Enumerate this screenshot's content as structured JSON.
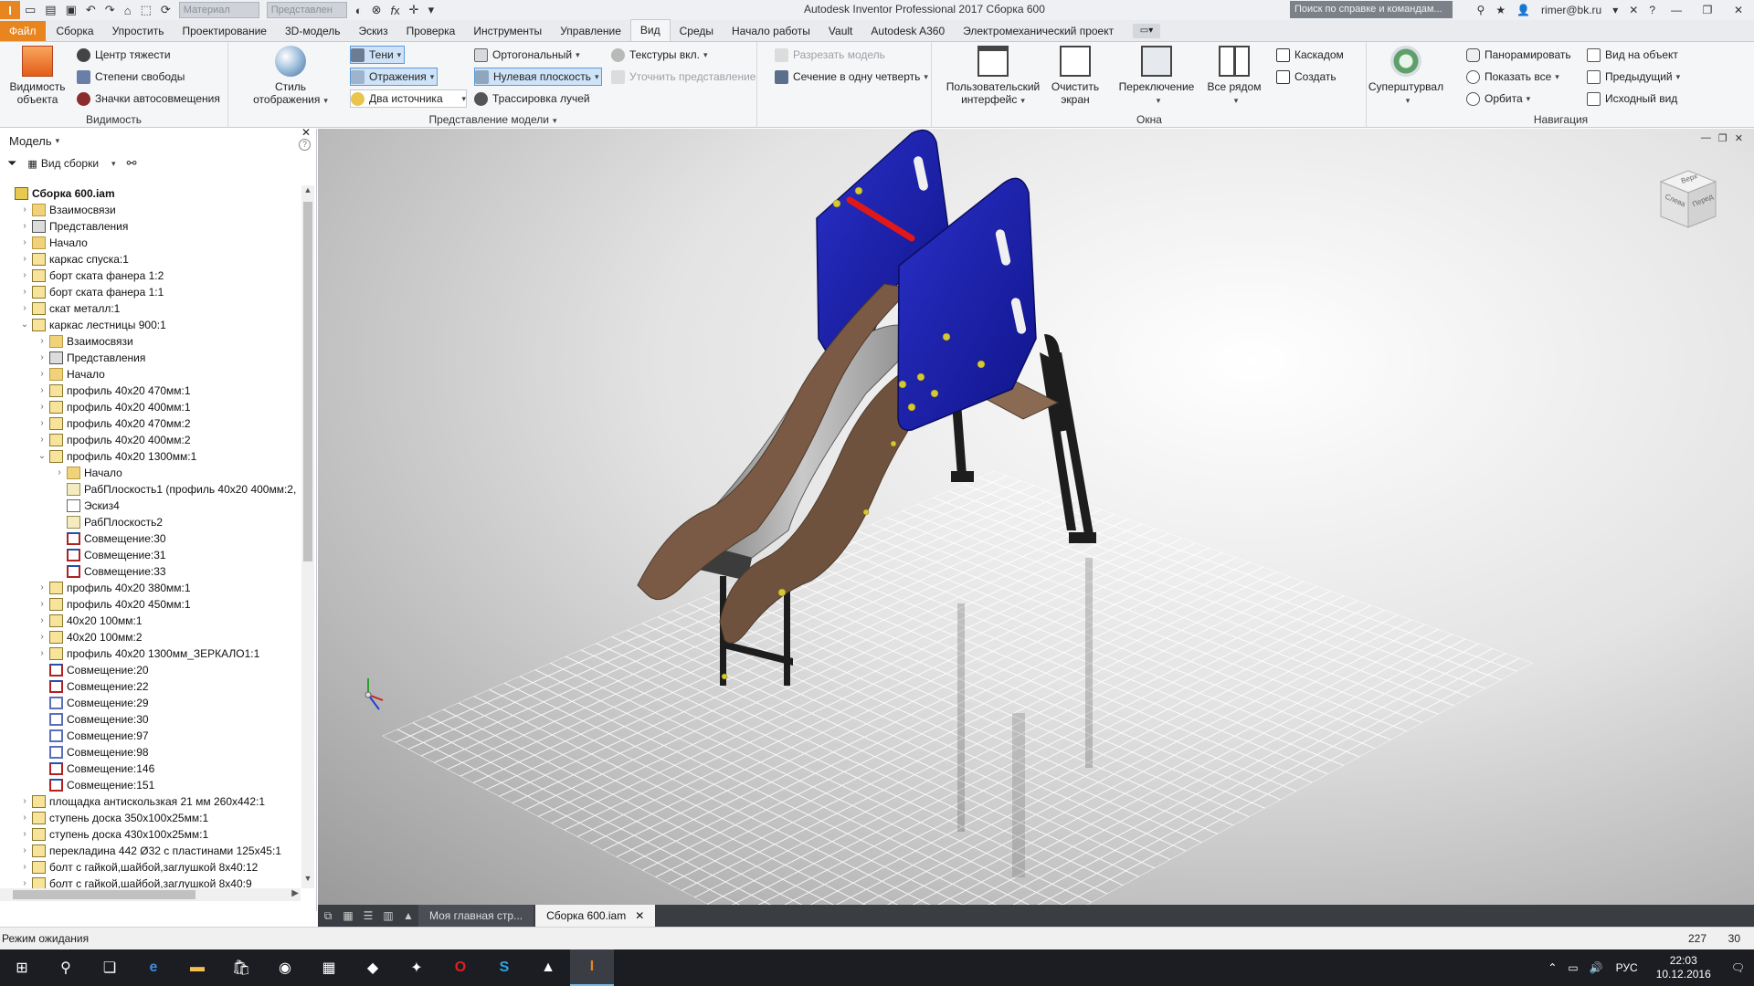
{
  "titlebar": {
    "material_field": "Материал",
    "representation_field": "Представлен",
    "app_title": "Autodesk Inventor Professional 2017   Сборка  600",
    "search_placeholder": "Поиск по справке и командам...",
    "user": "rimer@bk.ru"
  },
  "tabs": [
    {
      "label": "Файл",
      "kind": "file"
    },
    {
      "label": "Сборка"
    },
    {
      "label": "Упростить"
    },
    {
      "label": "Проектирование"
    },
    {
      "label": "3D-модель"
    },
    {
      "label": "Эскиз"
    },
    {
      "label": "Проверка"
    },
    {
      "label": "Инструменты"
    },
    {
      "label": "Управление"
    },
    {
      "label": "Вид",
      "active": true
    },
    {
      "label": "Среды"
    },
    {
      "label": "Начало работы"
    },
    {
      "label": "Vault"
    },
    {
      "label": "Autodesk A360"
    },
    {
      "label": "Электромеханический проект"
    }
  ],
  "ribbon": {
    "visibility": {
      "title": "Видимость",
      "object_visibility": "Видимость объекта",
      "center_of_gravity": "Центр тяжести",
      "dof": "Степени свободы",
      "autolimits": "Значки автосовмещения"
    },
    "appearance": {
      "title": "Представление модели",
      "visual_style": "Стиль отображения",
      "shadows": "Тени",
      "reflections": "Отражения",
      "two_lights": "Два источника",
      "orthographic": "Ортогональный",
      "ground_plane": "Нулевая плоскость",
      "ray_tracing": "Трассировка лучей",
      "textures": "Текстуры вкл.",
      "half_section": "Сечение в одну четверть",
      "slice": "Разрезать модель",
      "refine": "Уточнить представление"
    },
    "windows": {
      "title": "Окна",
      "user_interface": "Пользовательский интерфейс",
      "clean_screen": "Очистить экран",
      "switch": "Переключение",
      "tile": "Все рядом",
      "cascade": "Каскадом",
      "new": "Создать"
    },
    "navigation": {
      "title": "Навигация",
      "steering_wheel": "Суперштурвал",
      "pan": "Панорамировать",
      "zoom_all": "Показать все",
      "orbit": "Орбита",
      "look_at": "Вид на объект",
      "previous": "Предыдущий",
      "home": "Исходный вид"
    }
  },
  "browser": {
    "title": "Модель",
    "view_mode": "Вид сборки",
    "tree": [
      {
        "label": "Сборка  600.iam",
        "depth": 0,
        "icon": "asm",
        "bold": true
      },
      {
        "label": "Взаимосвязи",
        "depth": 1,
        "icon": "folder",
        "exp": "+"
      },
      {
        "label": "Представления",
        "depth": 1,
        "icon": "repr",
        "exp": "+"
      },
      {
        "label": "Начало",
        "depth": 1,
        "icon": "folder",
        "exp": "+"
      },
      {
        "label": "каркас спуска:1",
        "depth": 1,
        "icon": "part",
        "exp": "+"
      },
      {
        "label": "борт ската фанера 1:2",
        "depth": 1,
        "icon": "part",
        "exp": "+"
      },
      {
        "label": "борт ската фанера 1:1",
        "depth": 1,
        "icon": "part",
        "exp": "+"
      },
      {
        "label": "скат металл:1",
        "depth": 1,
        "icon": "part",
        "exp": "+"
      },
      {
        "label": "каркас лестницы 900:1",
        "depth": 1,
        "icon": "part",
        "exp": "-"
      },
      {
        "label": "Взаимосвязи",
        "depth": 2,
        "icon": "folder",
        "exp": "+"
      },
      {
        "label": "Представления",
        "depth": 2,
        "icon": "repr",
        "exp": "+"
      },
      {
        "label": "Начало",
        "depth": 2,
        "icon": "folder",
        "exp": "+"
      },
      {
        "label": "профиль 40x20  470мм:1",
        "depth": 2,
        "icon": "part",
        "exp": "+"
      },
      {
        "label": "профиль 40x20  400мм:1",
        "depth": 2,
        "icon": "part",
        "exp": "+"
      },
      {
        "label": "профиль 40x20  470мм:2",
        "depth": 2,
        "icon": "part",
        "exp": "+"
      },
      {
        "label": "профиль 40x20  400мм:2",
        "depth": 2,
        "icon": "part",
        "exp": "+"
      },
      {
        "label": "профиль 40x20  1300мм:1",
        "depth": 2,
        "icon": "part",
        "exp": "-"
      },
      {
        "label": "Начало",
        "depth": 3,
        "icon": "folder",
        "exp": "+"
      },
      {
        "label": "РабПлоскость1 (профиль 40x20  400мм:2,",
        "depth": 3,
        "icon": "plane"
      },
      {
        "label": "Эскиз4",
        "depth": 3,
        "icon": "sketch"
      },
      {
        "label": "РабПлоскость2",
        "depth": 3,
        "icon": "plane"
      },
      {
        "label": "Совмещение:30",
        "depth": 3,
        "icon": "cons"
      },
      {
        "label": "Совмещение:31",
        "depth": 3,
        "icon": "cons"
      },
      {
        "label": "Совмещение:33",
        "depth": 3,
        "icon": "cons"
      },
      {
        "label": "профиль 40x20  380мм:1",
        "depth": 2,
        "icon": "part",
        "exp": "+"
      },
      {
        "label": "профиль 40x20  450мм:1",
        "depth": 2,
        "icon": "part",
        "exp": "+"
      },
      {
        "label": "40x20 100мм:1",
        "depth": 2,
        "icon": "part",
        "exp": "+"
      },
      {
        "label": "40x20 100мм:2",
        "depth": 2,
        "icon": "part",
        "exp": "+"
      },
      {
        "label": "профиль 40x20  1300мм_ЗЕРКАЛО1:1",
        "depth": 2,
        "icon": "part",
        "exp": "+"
      },
      {
        "label": "Совмещение:20",
        "depth": 2,
        "icon": "cons"
      },
      {
        "label": "Совмещение:22",
        "depth": 2,
        "icon": "cons"
      },
      {
        "label": "Совмещение:29",
        "depth": 2,
        "icon": "cons2"
      },
      {
        "label": "Совмещение:30",
        "depth": 2,
        "icon": "cons2"
      },
      {
        "label": "Совмещение:97",
        "depth": 2,
        "icon": "cons2"
      },
      {
        "label": "Совмещение:98",
        "depth": 2,
        "icon": "cons2"
      },
      {
        "label": "Совмещение:146",
        "depth": 2,
        "icon": "cons"
      },
      {
        "label": "Совмещение:151",
        "depth": 2,
        "icon": "cons"
      },
      {
        "label": "площадка антискользкая 21 мм 260x442:1",
        "depth": 1,
        "icon": "part",
        "exp": "+"
      },
      {
        "label": "ступень доска  350x100x25мм:1",
        "depth": 1,
        "icon": "part",
        "exp": "+"
      },
      {
        "label": "ступень доска  430x100x25мм:1",
        "depth": 1,
        "icon": "part",
        "exp": "+"
      },
      {
        "label": "перекладина 442  Ø32 с пластинами 125x45:1",
        "depth": 1,
        "icon": "part",
        "exp": "+"
      },
      {
        "label": "болт с гайкой,шайбой,заглушкой 8x40:12",
        "depth": 1,
        "icon": "part",
        "exp": "+"
      },
      {
        "label": "болт с гайкой,шайбой,заглушкой 8x40:9",
        "depth": 1,
        "icon": "part",
        "exp": "+"
      }
    ]
  },
  "viewcube": {
    "top": "Верх",
    "left": "Слева",
    "front": "Перед"
  },
  "doc_tabs": [
    {
      "label": "Моя главная стр..."
    },
    {
      "label": "Сборка  600.iam",
      "active": true
    }
  ],
  "status": {
    "text": "Режим ожидания",
    "count1": "227",
    "count2": "30"
  },
  "taskbar": {
    "lang": "РУС",
    "time": "22:03",
    "date": "10.12.2016"
  },
  "colors": {
    "file_tab": "#e8851f",
    "panel_blue": "#1a1fa8",
    "wood": "#7a5a44",
    "steel": "#a9a9a9",
    "handle": "#d91818"
  }
}
